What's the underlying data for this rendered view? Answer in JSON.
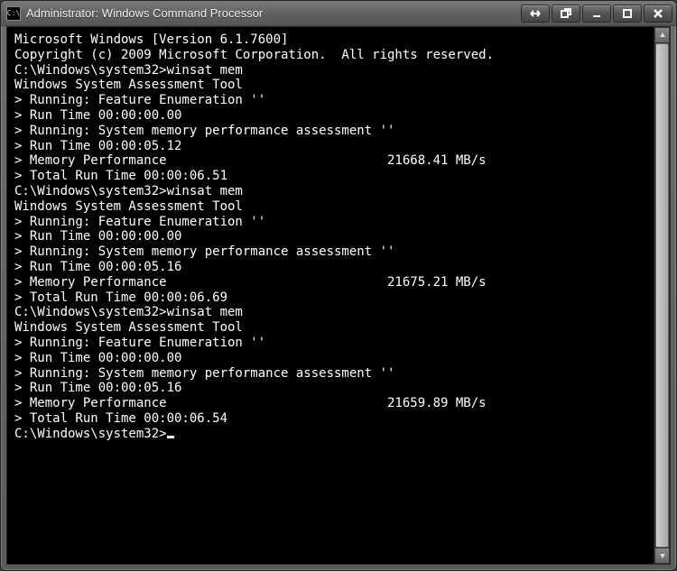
{
  "window": {
    "title": "Administrator: Windows Command Processor",
    "icon_label": "C:\\"
  },
  "terminal": {
    "header1": "Microsoft Windows [Version 6.1.7600]",
    "header2": "Copyright (c) 2009 Microsoft Corporation.  All rights reserved.",
    "prompt_path": "C:\\Windows\\system32>",
    "command": "winsat mem",
    "tool_title": "Windows System Assessment Tool",
    "runs": [
      {
        "l1": "> Running: Feature Enumeration ''",
        "l2": "> Run Time 00:00:00.00",
        "l3": "> Running: System memory performance assessment ''",
        "l4": "> Run Time 00:00:05.12",
        "l5_label": "> Memory Performance",
        "l5_value": "21668.41 MB/s",
        "l6": "> Total Run Time 00:00:06.51"
      },
      {
        "l1": "> Running: Feature Enumeration ''",
        "l2": "> Run Time 00:00:00.00",
        "l3": "> Running: System memory performance assessment ''",
        "l4": "> Run Time 00:00:05.16",
        "l5_label": "> Memory Performance",
        "l5_value": "21675.21 MB/s",
        "l6": "> Total Run Time 00:00:06.69"
      },
      {
        "l1": "> Running: Feature Enumeration ''",
        "l2": "> Run Time 00:00:00.00",
        "l3": "> Running: System memory performance assessment ''",
        "l4": "> Run Time 00:00:05.16",
        "l5_label": "> Memory Performance",
        "l5_value": "21659.89 MB/s",
        "l6": "> Total Run Time 00:00:06.54"
      }
    ]
  }
}
